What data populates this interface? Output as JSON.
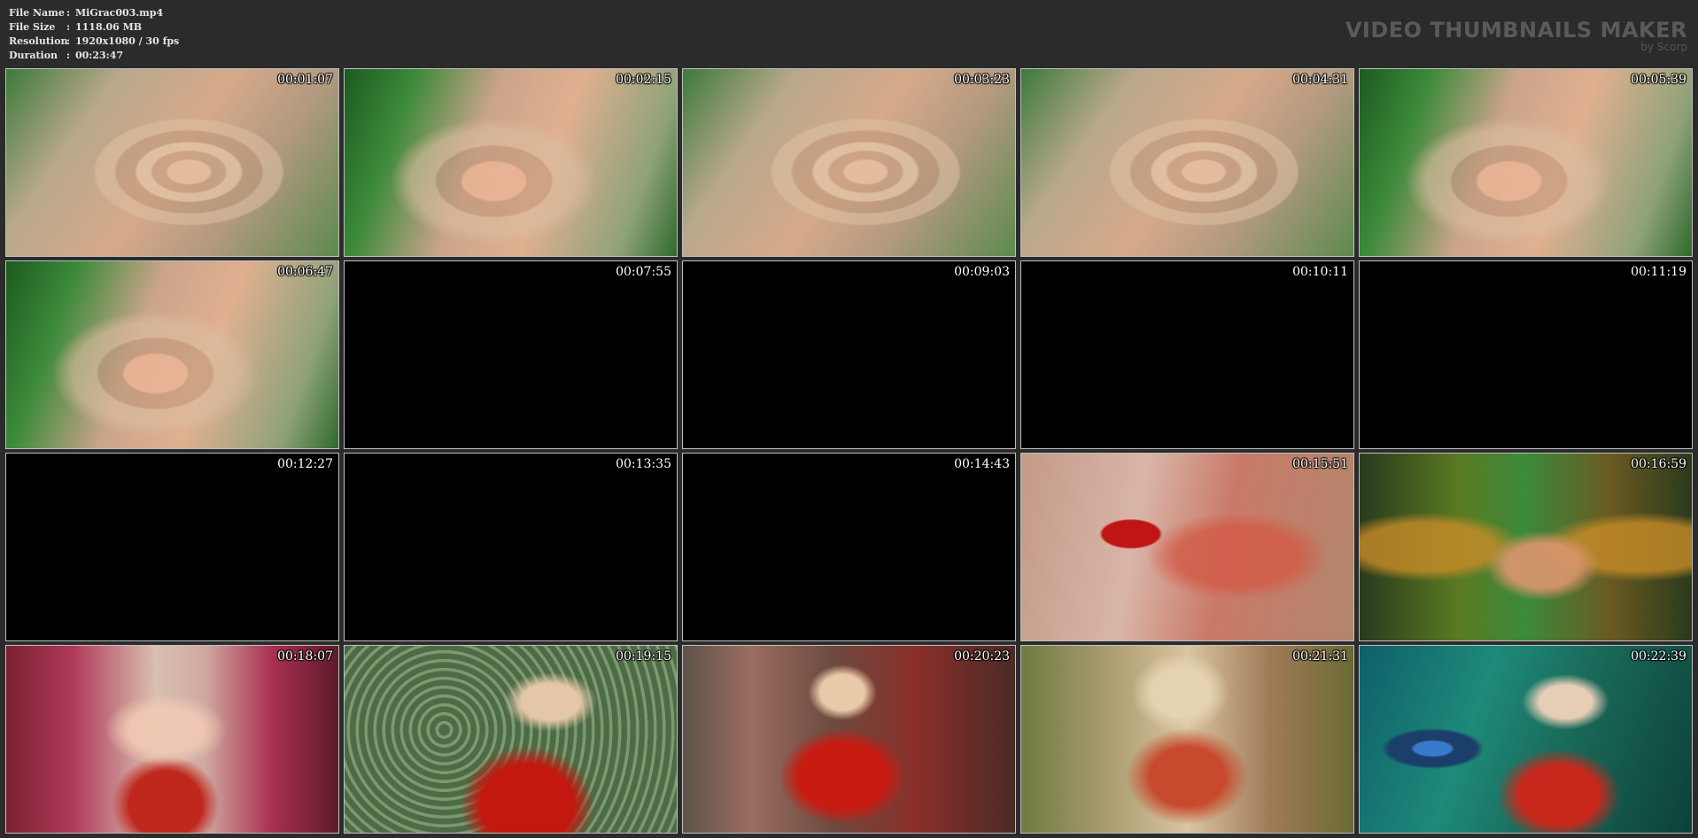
{
  "info": {
    "rows": [
      {
        "label": "File Name",
        "sep": ":",
        "value": "MiGrac003.mp4"
      },
      {
        "label": "File Size",
        "sep": ":",
        "value": "1118.06 MB"
      },
      {
        "label": "Resolution",
        "sep": ":",
        "value": "1920x1080 / 30 fps"
      },
      {
        "label": "Duration",
        "sep": ":",
        "value": "00:23:47"
      }
    ]
  },
  "brand": {
    "title": "VIDEO THUMBNAILS MAKER",
    "subtitle": "by Scorp"
  },
  "thumbnails": [
    {
      "time": "00:01:07",
      "scene": "hypno"
    },
    {
      "time": "00:02:15",
      "scene": "hypno2"
    },
    {
      "time": "00:03:23",
      "scene": "hypno"
    },
    {
      "time": "00:04:31",
      "scene": "hypno"
    },
    {
      "time": "00:05:39",
      "scene": "hypno2"
    },
    {
      "time": "00:06:47",
      "scene": "hypno2"
    },
    {
      "time": "00:07:55",
      "scene": "black"
    },
    {
      "time": "00:09:03",
      "scene": "black"
    },
    {
      "time": "00:10:11",
      "scene": "black"
    },
    {
      "time": "00:11:19",
      "scene": "black"
    },
    {
      "time": "00:12:27",
      "scene": "black"
    },
    {
      "time": "00:13:35",
      "scene": "black"
    },
    {
      "time": "00:14:43",
      "scene": "black"
    },
    {
      "time": "00:15:51",
      "scene": "lips"
    },
    {
      "time": "00:16:59",
      "scene": "psy"
    },
    {
      "time": "00:18:07",
      "scene": "net"
    },
    {
      "time": "00:19:15",
      "scene": "clock"
    },
    {
      "time": "00:20:23",
      "scene": "glitter"
    },
    {
      "time": "00:21:31",
      "scene": "haze"
    },
    {
      "time": "00:22:39",
      "scene": "eye"
    }
  ]
}
